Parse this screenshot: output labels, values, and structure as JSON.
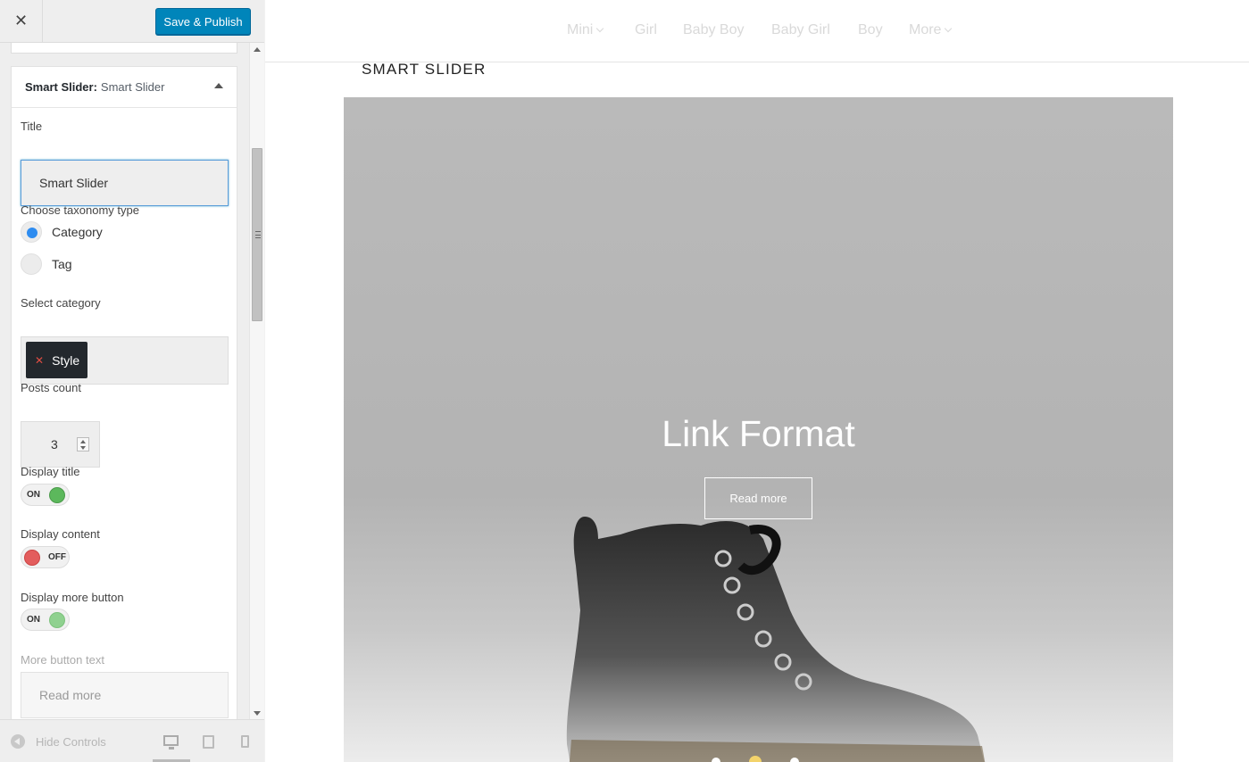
{
  "header": {
    "close_symbol": "✕",
    "publish_label": "Save & Publish"
  },
  "section": {
    "title_strong": "Smart Slider:",
    "title_sub": "Smart Slider"
  },
  "form": {
    "title_label": "Title",
    "title_value": "Smart Slider",
    "taxonomy_label": "Choose taxonomy type",
    "taxonomy_options": [
      "Category",
      "Tag"
    ],
    "taxonomy_selected": "Category",
    "category_label": "Select category",
    "selected_category": "Style",
    "posts_count_label": "Posts count",
    "posts_count_value": "3",
    "display_title_label": "Display title",
    "display_title_state": "ON",
    "display_content_label": "Display content",
    "display_content_state": "OFF",
    "display_more_label": "Display more button",
    "display_more_state": "ON",
    "more_text_label": "More button text",
    "more_text_value": "Read more"
  },
  "footer": {
    "hide_controls_label": "Hide Controls",
    "devices": [
      "desktop-icon",
      "tablet-icon",
      "mobile-icon"
    ]
  },
  "preview": {
    "nav": [
      "Mini",
      "Girl",
      "Baby Boy",
      "Baby Girl",
      "Boy",
      "More"
    ],
    "widget_title": "SMART SLIDER",
    "slide_title": "Link Format",
    "slide_button": "Read more",
    "slide_count": 3,
    "active_slide": 2
  },
  "colors": {
    "primary": "#0085ba",
    "toggle_on": "#5cb85c",
    "toggle_off": "#e35d5d",
    "radio_checked": "#2e8cf0",
    "active_dot": "#f3d36b"
  }
}
